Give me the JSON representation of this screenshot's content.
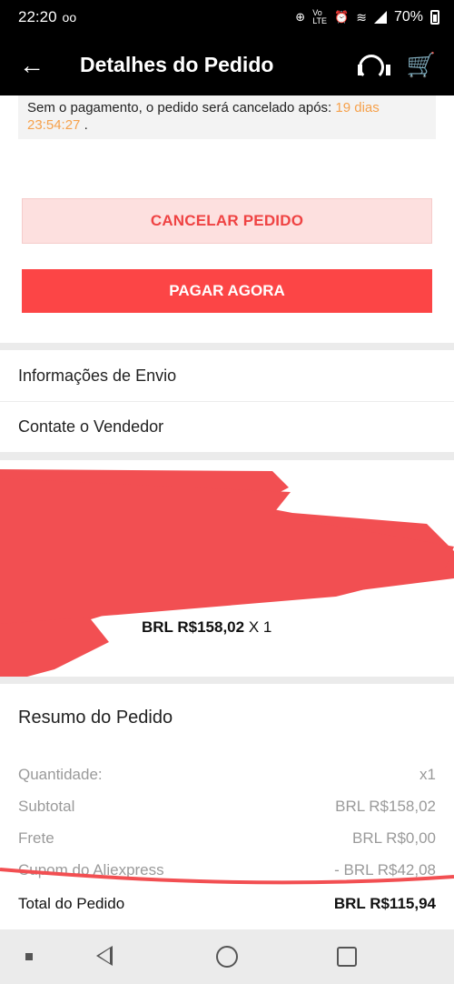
{
  "status_bar": {
    "time": "22:20",
    "voicemail_icon": "oo",
    "icons": [
      "data-saver-icon",
      "volte-icon",
      "alarm-icon",
      "wifi-icon",
      "signal-icon"
    ],
    "battery": "70%"
  },
  "app_bar": {
    "title": "Detalhes do Pedido",
    "back_icon": "back-arrow-icon",
    "support_icon": "headset-icon",
    "cart_icon": "cart-icon"
  },
  "notice": {
    "text": "Sem o pagamento, o pedido será cancelado após:",
    "countdown": "19 dias 23:54:27",
    "suffix": "."
  },
  "actions": {
    "cancel_label": "CANCELAR PEDIDO",
    "pay_label": "PAGAR AGORA"
  },
  "links": {
    "shipping": "Informações de Envio",
    "contact_seller": "Contate o Vendedor"
  },
  "product": {
    "price": "BRL R$158,02",
    "quantity": "X 1"
  },
  "summary": {
    "title": "Resumo do Pedido",
    "rows": [
      {
        "label": "Quantidade:",
        "value": "x1"
      },
      {
        "label": "Subtotal",
        "value": "BRL R$158,02"
      },
      {
        "label": "Frete",
        "value": "BRL R$0,00"
      },
      {
        "label": "Cupom do Aliexpress",
        "value": "- BRL R$42,08"
      }
    ],
    "total_label": "Total do Pedido",
    "total_value": "BRL R$115,94"
  },
  "colors": {
    "accent": "#fc4546",
    "countdown": "#f6a14b",
    "redaction": "#f24f52"
  }
}
